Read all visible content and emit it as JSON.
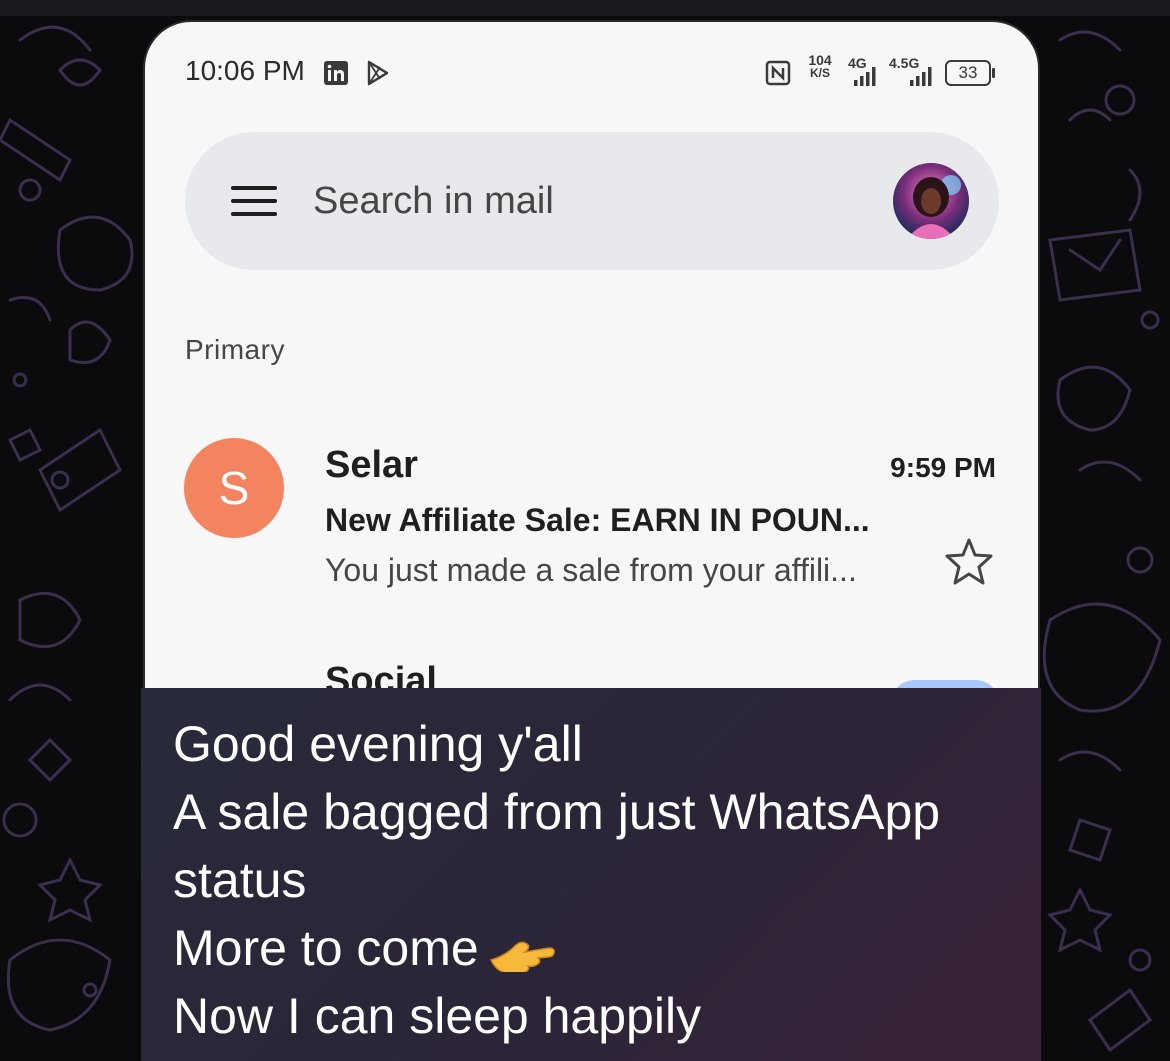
{
  "status_bar": {
    "time": "10:06 PM",
    "speed_value": "104",
    "speed_unit": "K/S",
    "network_1": "4G",
    "network_2": "4.5G",
    "battery": "33"
  },
  "search": {
    "placeholder": "Search in mail"
  },
  "inbox": {
    "section_label": "Primary",
    "emails": [
      {
        "avatar_letter": "S",
        "avatar_color": "#f4845f",
        "sender": "Selar",
        "time": "9:59 PM",
        "subject": "New Affiliate Sale: EARN IN POUN...",
        "snippet": "You just made a sale from your affili..."
      }
    ],
    "next_row_label": "Social"
  },
  "caption": {
    "line1": "Good evening y'all",
    "line2": "A sale bagged from just WhatsApp",
    "line3": "status",
    "line4": "More to come",
    "line5": "Now I can sleep happily"
  },
  "colors": {
    "accent_chip": "#a8c7fa",
    "background": "#0b0a0d",
    "doodle_stroke": "#3d3150"
  },
  "icons": {
    "status_left": [
      "linkedin-icon",
      "play-store-icon"
    ],
    "status_right": [
      "nfc-icon",
      "signal-icon",
      "battery-icon"
    ],
    "search": [
      "menu-icon",
      "profile-avatar"
    ],
    "email": [
      "star-icon"
    ],
    "caption_emoji": "hand-pointing-icon"
  }
}
